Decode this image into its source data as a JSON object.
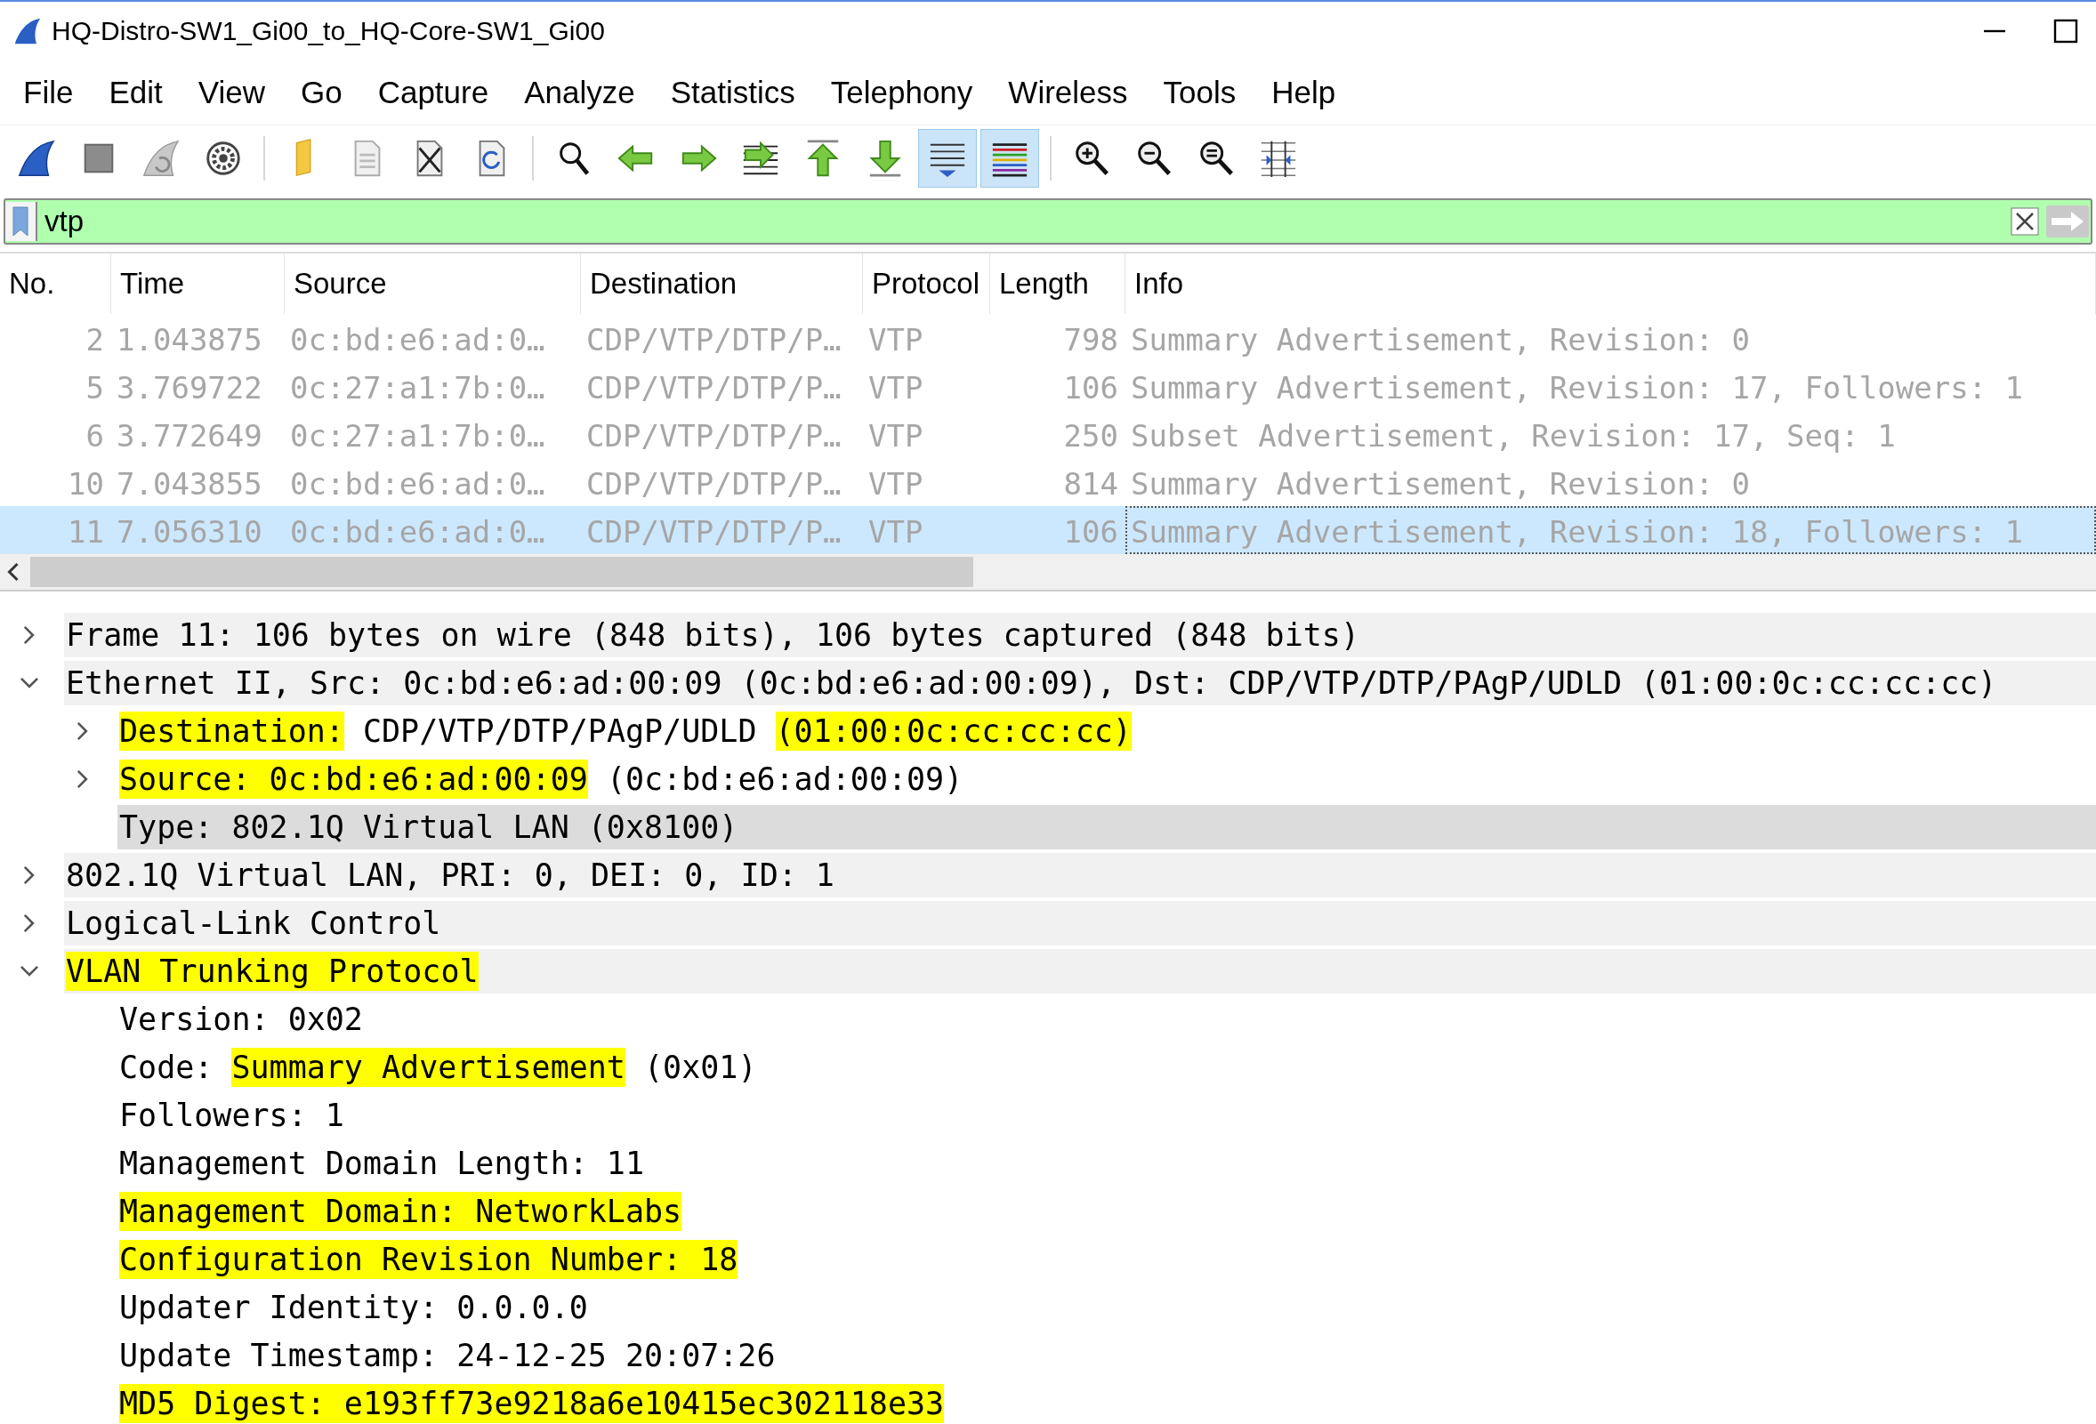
{
  "window": {
    "title": "HQ-Distro-SW1_Gi00_to_HQ-Core-SW1_Gi00"
  },
  "menu": [
    "File",
    "Edit",
    "View",
    "Go",
    "Capture",
    "Analyze",
    "Statistics",
    "Telephony",
    "Wireless",
    "Tools",
    "Help"
  ],
  "toolbar": [
    {
      "kind": "start",
      "pressed": false
    },
    {
      "kind": "stop",
      "pressed": false
    },
    {
      "kind": "restart",
      "pressed": false
    },
    {
      "kind": "options",
      "pressed": false
    },
    {
      "kind": "separator"
    },
    {
      "kind": "open",
      "pressed": false
    },
    {
      "kind": "file",
      "pressed": false
    },
    {
      "kind": "close",
      "pressed": false
    },
    {
      "kind": "reload",
      "pressed": false
    },
    {
      "kind": "separator"
    },
    {
      "kind": "find",
      "pressed": false
    },
    {
      "kind": "back",
      "pressed": false
    },
    {
      "kind": "forward",
      "pressed": false
    },
    {
      "kind": "goto",
      "pressed": false
    },
    {
      "kind": "first",
      "pressed": false
    },
    {
      "kind": "last",
      "pressed": false
    },
    {
      "kind": "autoscroll",
      "pressed": true
    },
    {
      "kind": "colorize",
      "pressed": true
    },
    {
      "kind": "separator"
    },
    {
      "kind": "zoomin",
      "pressed": false
    },
    {
      "kind": "zoomout",
      "pressed": false
    },
    {
      "kind": "zoomreset",
      "pressed": false
    },
    {
      "kind": "resize",
      "pressed": false
    }
  ],
  "filter": {
    "value": "vtp"
  },
  "packet_list": {
    "columns": [
      "No.",
      "Time",
      "Source",
      "Destination",
      "Protocol",
      "Length",
      "Info"
    ],
    "rows": [
      {
        "cells": [
          "2",
          "1.043875",
          "0c:bd:e6:ad:0…",
          "CDP/VTP/DTP/P…",
          "VTP",
          "798",
          "Summary Advertisement, Revision: 0"
        ],
        "selected": false
      },
      {
        "cells": [
          "5",
          "3.769722",
          "0c:27:a1:7b:0…",
          "CDP/VTP/DTP/P…",
          "VTP",
          "106",
          "Summary Advertisement, Revision: 17, Followers: 1"
        ],
        "selected": false
      },
      {
        "cells": [
          "6",
          "3.772649",
          "0c:27:a1:7b:0…",
          "CDP/VTP/DTP/P…",
          "VTP",
          "250",
          "Subset Advertisement, Revision: 17, Seq: 1"
        ],
        "selected": false
      },
      {
        "cells": [
          "10",
          "7.043855",
          "0c:bd:e6:ad:0…",
          "CDP/VTP/DTP/P…",
          "VTP",
          "814",
          "Summary Advertisement, Revision: 0"
        ],
        "selected": false
      },
      {
        "cells": [
          "11",
          "7.056310",
          "0c:bd:e6:ad:0…",
          "CDP/VTP/DTP/P…",
          "VTP",
          "106",
          "Summary Advertisement, Revision: 18, Followers: 1"
        ],
        "selected": true
      }
    ]
  },
  "details": [
    {
      "segments": [
        {
          "text": "Frame 11: 106 bytes on wire (848 bits), 106 bytes captured (848 bits)",
          "highlight": false
        }
      ],
      "expanded": false,
      "selected": false
    },
    {
      "segments": [
        {
          "text": "Ethernet II, Src: 0c:bd:e6:ad:00:09 (0c:bd:e6:ad:00:09), Dst: CDP/VTP/DTP/PAgP/UDLD (01:00:0c:cc:cc:cc)",
          "highlight": false
        }
      ],
      "expanded": true,
      "selected": false,
      "children": [
        {
          "segments": [
            {
              "text": "Destination:",
              "highlight": true
            },
            {
              "text": " CDP/VTP/DTP/PAgP/UDLD ",
              "highlight": false
            },
            {
              "text": "(01:00:0c:cc:cc:cc)",
              "highlight": true
            }
          ],
          "expanded": false,
          "selected": false
        },
        {
          "segments": [
            {
              "text": "Source: ",
              "highlight": true
            },
            {
              "text": "0c:bd:e6:ad:00:09",
              "highlight": true
            },
            {
              "text": " (0c:bd:e6:ad:00:09)",
              "highlight": false
            }
          ],
          "expanded": false,
          "selected": false
        },
        {
          "segments": [
            {
              "text": "Type: 802.1Q Virtual LAN (0x8100)",
              "highlight": false
            }
          ],
          "selected": true
        }
      ]
    },
    {
      "segments": [
        {
          "text": "802.1Q Virtual LAN, PRI: 0, DEI: 0, ID: 1",
          "highlight": false
        }
      ],
      "expanded": false,
      "selected": false
    },
    {
      "segments": [
        {
          "text": "Logical-Link Control",
          "highlight": false
        }
      ],
      "expanded": false,
      "selected": false
    },
    {
      "segments": [
        {
          "text": "VLAN Trunking Protocol",
          "highlight": true
        }
      ],
      "expanded": true,
      "selected": false,
      "children": [
        {
          "segments": [
            {
              "text": "Version: 0x02",
              "highlight": false
            }
          ],
          "selected": false
        },
        {
          "segments": [
            {
              "text": "Code: ",
              "highlight": false
            },
            {
              "text": "Summary Advertisement",
              "highlight": true
            },
            {
              "text": " (0x01)",
              "highlight": false
            }
          ],
          "selected": false
        },
        {
          "segments": [
            {
              "text": "Followers: 1",
              "highlight": false
            }
          ],
          "selected": false
        },
        {
          "segments": [
            {
              "text": "Management Domain Length: 11",
              "highlight": false
            }
          ],
          "selected": false
        },
        {
          "segments": [
            {
              "text": "Management Domain: NetworkLabs",
              "highlight": true
            }
          ],
          "selected": false
        },
        {
          "segments": [
            {
              "text": "Configuration Revision Number: 18",
              "highlight": true
            }
          ],
          "selected": false
        },
        {
          "segments": [
            {
              "text": "Updater Identity: 0.0.0.0",
              "highlight": false
            }
          ],
          "selected": false
        },
        {
          "segments": [
            {
              "text": "Update Timestamp: 24-12-25 20:07:26",
              "highlight": false
            }
          ],
          "selected": false
        },
        {
          "segments": [
            {
              "text": "MD5 Digest: e193ff73e9218a6e10415ec302118e33",
              "highlight": true
            }
          ],
          "selected": false
        }
      ]
    }
  ]
}
